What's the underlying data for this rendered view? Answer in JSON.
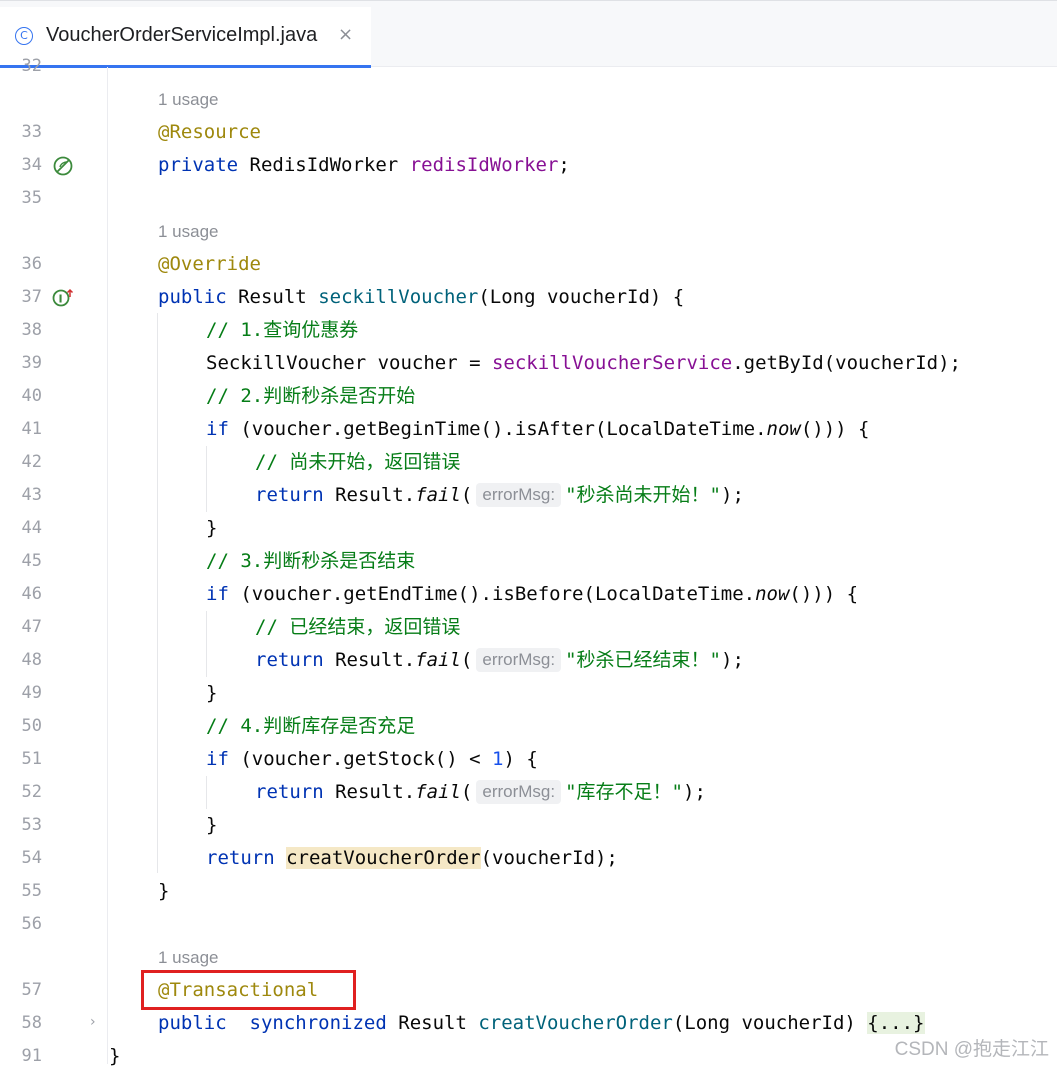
{
  "tab": {
    "title": "VoucherOrderServiceImpl.java",
    "icon": "class-icon",
    "close_glyph": "×"
  },
  "usage": {
    "label": "1 usage"
  },
  "lines": {
    "l32": "32",
    "l33": "33",
    "l34": "34",
    "l35": "35",
    "l36": "36",
    "l37": "37",
    "l38": "38",
    "l39": "39",
    "l40": "40",
    "l41": "41",
    "l42": "42",
    "l43": "43",
    "l44": "44",
    "l45": "45",
    "l46": "46",
    "l47": "47",
    "l48": "48",
    "l49": "49",
    "l50": "50",
    "l51": "51",
    "l52": "52",
    "l53": "53",
    "l54": "54",
    "l55": "55",
    "l56": "56",
    "l57": "57",
    "l58": "58",
    "l91": "91"
  },
  "code": {
    "resource_ann": "@Resource",
    "private_kw": "private",
    "redis_type": "RedisIdWorker",
    "redis_field": "redisIdWorker",
    "override_ann": "@Override",
    "public_kw": "public",
    "result_type": "Result",
    "seckill_method": "seckillVoucher",
    "long_param": "(Long voucherId) {",
    "comment1": "// 1.查询优惠券",
    "seckill_voucher_decl": "SeckillVoucher voucher = ",
    "service_field": "seckillVoucherService",
    "get_by_id": ".getById(voucherId);",
    "comment2": "// 2.判断秒杀是否开始",
    "if_kw": "if",
    "if1_expr": " (voucher.getBeginTime().isAfter(LocalDateTime.",
    "now": "now",
    "close_parens": "())) {",
    "comment_not_start": "// 尚未开始，返回错误",
    "return_kw": "return",
    "result_dot": " Result.",
    "fail": "fail",
    "open_paren": "(",
    "hint_label": "errorMsg:",
    "str_not_start": "\"秒杀尚未开始！\"",
    "close_stmt": ");",
    "close_brace": "}",
    "comment3": "// 3.判断秒杀是否结束",
    "if2_expr": " (voucher.getEndTime().isBefore(LocalDateTime.",
    "comment_ended": "// 已经结束，返回错误",
    "str_ended": "\"秒杀已经结束！\"",
    "comment4": "// 4.判断库存是否充足",
    "if3_expr": " (voucher.getStock() < ",
    "one": "1",
    "if3_tail": ") {",
    "str_stock": "\"库存不足！\"",
    "creat_call": "creatVoucherOrder",
    "creat_args": "(voucherId);",
    "transactional_ann": "@Transactional",
    "synchronized_kw": "synchronized",
    "creat_method": "creatVoucherOrder",
    "folded": "{...}"
  },
  "watermark": "CSDN @抱走江江",
  "colors": {
    "keyword": "#0033b3",
    "annotation": "#9e880d",
    "field": "#871094",
    "method": "#00627a",
    "comment": "#067d17",
    "accent": "#3574f0",
    "highlight": "#e02020"
  }
}
